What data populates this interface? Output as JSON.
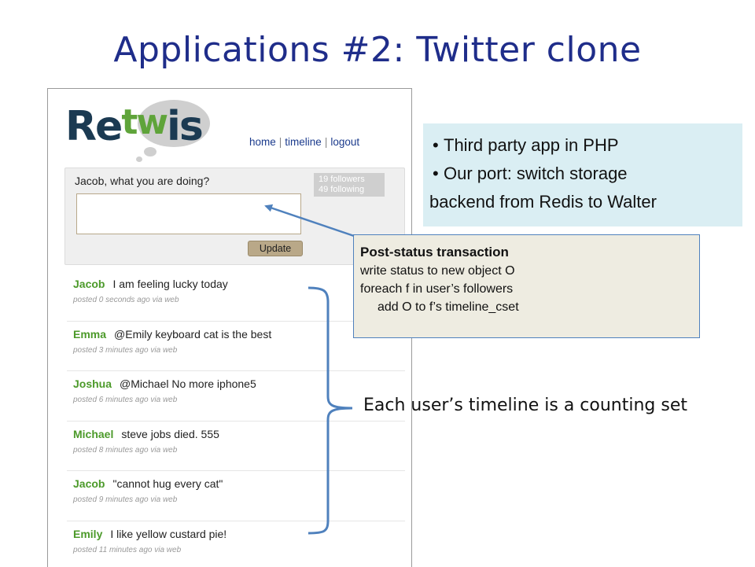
{
  "slide": {
    "title": "Applications #2: Twitter clone"
  },
  "app": {
    "logo": {
      "text_part1": "Re",
      "text_part2": "tw",
      "text_part3": "is"
    },
    "nav": {
      "home": "home",
      "timeline": "timeline",
      "logout": "logout",
      "separator": "|"
    },
    "composer": {
      "prompt": "Jacob, what you are doing?",
      "input_value": "",
      "button_label": "Update",
      "followers": "19 followers",
      "following": "49 following"
    },
    "feed": [
      {
        "user": "Jacob",
        "text": "I am feeling lucky today",
        "time": "posted 0 seconds ago via web"
      },
      {
        "user": "Emma",
        "text": "@Emily keyboard cat is the best",
        "time": "posted 3 minutes ago via web"
      },
      {
        "user": "Joshua",
        "text": "@Michael No more iphone5",
        "time": "posted 6 minutes ago via web"
      },
      {
        "user": "Michael",
        "text": "steve jobs died. 555",
        "time": "posted 8 minutes ago via web"
      },
      {
        "user": "Jacob",
        "text": "\"cannot hug every cat\"",
        "time": "posted 9 minutes ago via web"
      },
      {
        "user": "Emily",
        "text": "I like yellow custard pie!",
        "time": "posted 11 minutes ago via web"
      }
    ]
  },
  "callouts": {
    "info": {
      "bullet1": "Third party app in PHP",
      "bullet2_line1": "Our port: switch storage",
      "bullet2_line2": "backend from Redis to Walter"
    },
    "transaction": {
      "title": "Post-status transaction",
      "line1": "write status to new object O",
      "line2": "foreach f in user’s followers",
      "line3": "add O to f’s timeline_cset"
    },
    "timeline_note": "Each user’s timeline is a counting set"
  },
  "colors": {
    "title": "#1f2d8a",
    "brace_arrow": "#4f81bd",
    "info_bg": "#daeef3",
    "tx_bg": "#eeece1",
    "username": "#4c9a2a",
    "logo_dark": "#1b3a52",
    "logo_green": "#5fa43a"
  }
}
